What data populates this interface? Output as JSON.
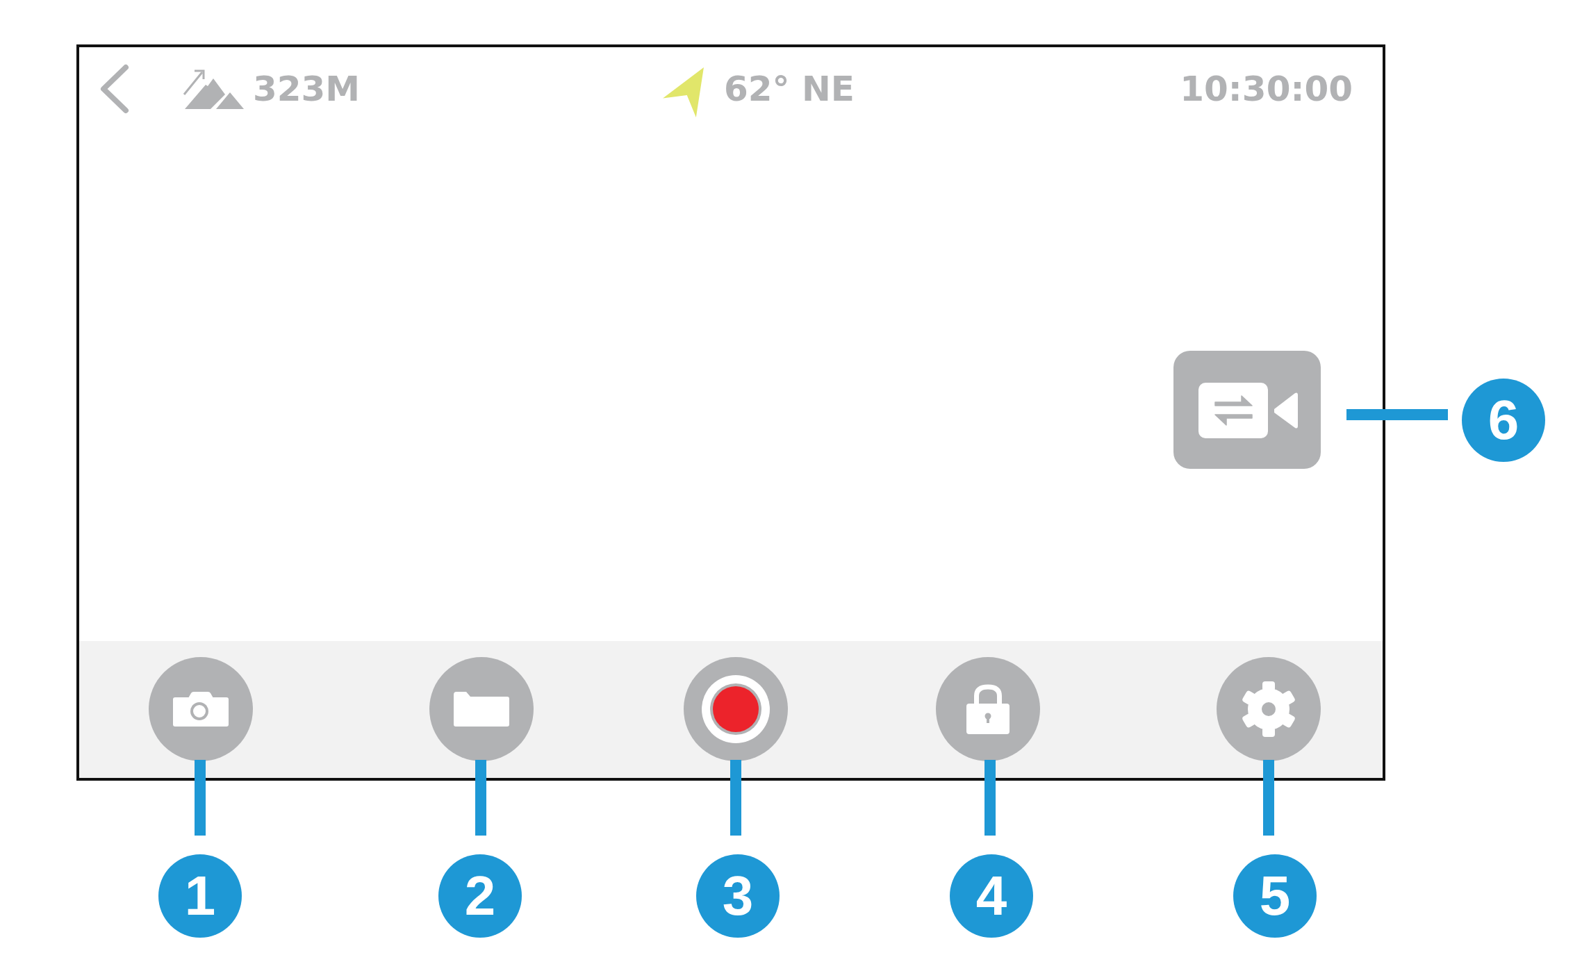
{
  "status_bar": {
    "altitude": "323M",
    "heading": "62° NE",
    "time": "10:30:00"
  },
  "callouts": [
    {
      "number": "1"
    },
    {
      "number": "2"
    },
    {
      "number": "3"
    },
    {
      "number": "4"
    },
    {
      "number": "5"
    },
    {
      "number": "6"
    }
  ]
}
